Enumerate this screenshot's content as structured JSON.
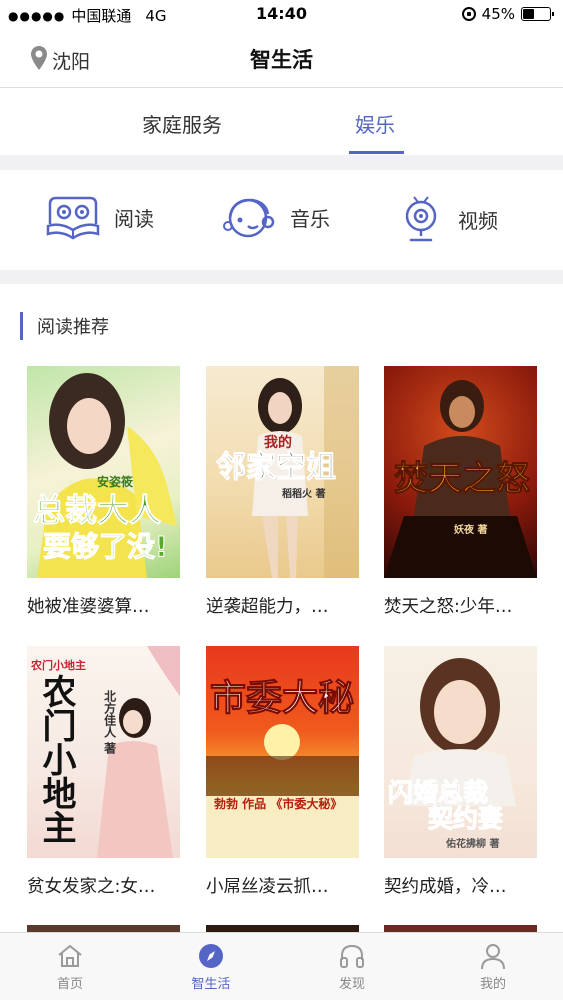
{
  "status_bar": {
    "signal": "●●●●●",
    "carrier": "中国联通",
    "network": "4G",
    "time": "14:40",
    "battery_text": "45%",
    "battery_level": 0.45
  },
  "nav": {
    "location": "沈阳",
    "title": "智生活"
  },
  "tabs": [
    {
      "label": "家庭服务",
      "active": false
    },
    {
      "label": "娱乐",
      "active": true
    }
  ],
  "categories": [
    {
      "label": "阅读",
      "icon": "book-reader-icon"
    },
    {
      "label": "音乐",
      "icon": "music-face-icon"
    },
    {
      "label": "视频",
      "icon": "webcam-icon"
    }
  ],
  "section": {
    "title": "阅读推荐"
  },
  "books": [
    {
      "title": "她被准婆婆算…",
      "cover_text": [
        "安姿筱",
        "总裁大人",
        "要够了没!"
      ]
    },
    {
      "title": "逆袭超能力，…",
      "cover_text": [
        "我的",
        "邻家空姐",
        "稻稻火 著"
      ]
    },
    {
      "title": "焚天之怒:少年…",
      "cover_text": [
        "焚天之怒",
        "妖夜 著"
      ]
    },
    {
      "title": "贫女发家之:女…",
      "cover_text": [
        "农门小地主",
        "北方佳人 著"
      ]
    },
    {
      "title": "小屌丝凌云抓…",
      "cover_text": [
        "市委大秘",
        "勃勃 作品 《市委大秘》"
      ]
    },
    {
      "title": "契约成婚，冷…",
      "cover_text": [
        "闪婚总裁",
        "契约妻",
        "佑花拂柳 著"
      ]
    }
  ],
  "tab_bar": [
    {
      "label": "首页",
      "icon": "home-icon",
      "active": false
    },
    {
      "label": "智生活",
      "icon": "compass-icon",
      "active": true
    },
    {
      "label": "发现",
      "icon": "headphones-icon",
      "active": false
    },
    {
      "label": "我的",
      "icon": "person-icon",
      "active": false
    }
  ],
  "colors": {
    "accent": "#5565c6",
    "text": "#222222",
    "band": "#f1f1f3"
  }
}
